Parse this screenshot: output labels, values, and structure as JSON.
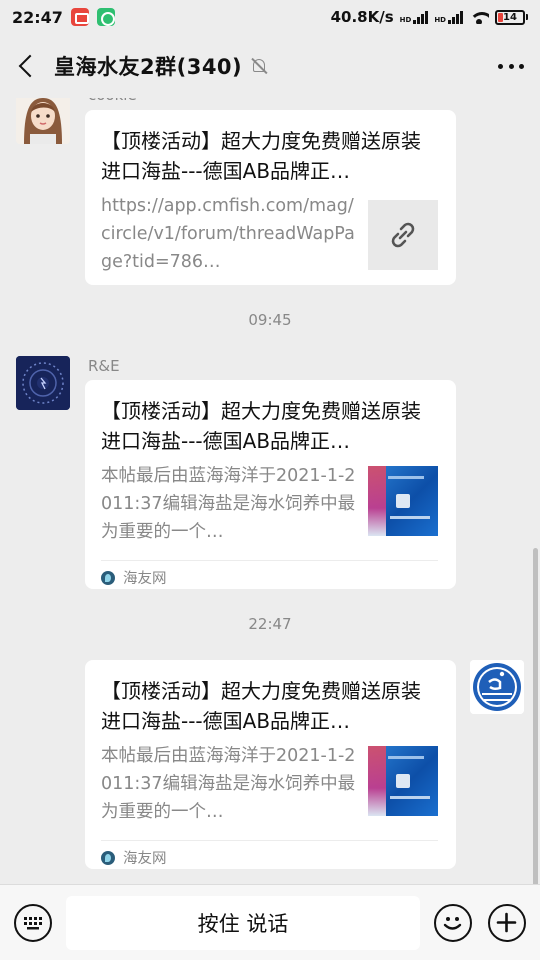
{
  "status_bar": {
    "time": "22:47",
    "network_speed": "40.8K/s",
    "signal_label_1": "HD",
    "signal_label_2": "HD",
    "battery": "14"
  },
  "header": {
    "title": "皇海水友2群(340)"
  },
  "messages": [
    {
      "sender": "cookie",
      "title": "【顶楼活动】超大力度免费赠送原装进口海盐---德国AB品牌正…",
      "desc": "https://app.cmfish.com/mag/circle/v1/forum/threadWapPage?tid=786…"
    },
    {
      "time": "09:45"
    },
    {
      "sender": "R&E",
      "title": "【顶楼活动】超大力度免费赠送原装进口海盐---德国AB品牌正…",
      "desc": "本帖最后由蓝海海洋于2021-1-2011:37编辑海盐是海水饲养中最为重要的一个…",
      "source": "海友网"
    },
    {
      "time": "22:47"
    },
    {
      "sender": "",
      "title": "【顶楼活动】超大力度免费赠送原装进口海盐---德国AB品牌正…",
      "desc": "本帖最后由蓝海海洋于2021-1-2011:37编辑海盐是海水饲养中最为重要的一个…",
      "source": "海友网"
    }
  ],
  "bottom_bar": {
    "hold_to_talk": "按住 说话"
  },
  "colors": {
    "background": "#ededed",
    "card": "#ffffff",
    "secondary_text": "#888888",
    "battery_low": "#e8453c"
  }
}
